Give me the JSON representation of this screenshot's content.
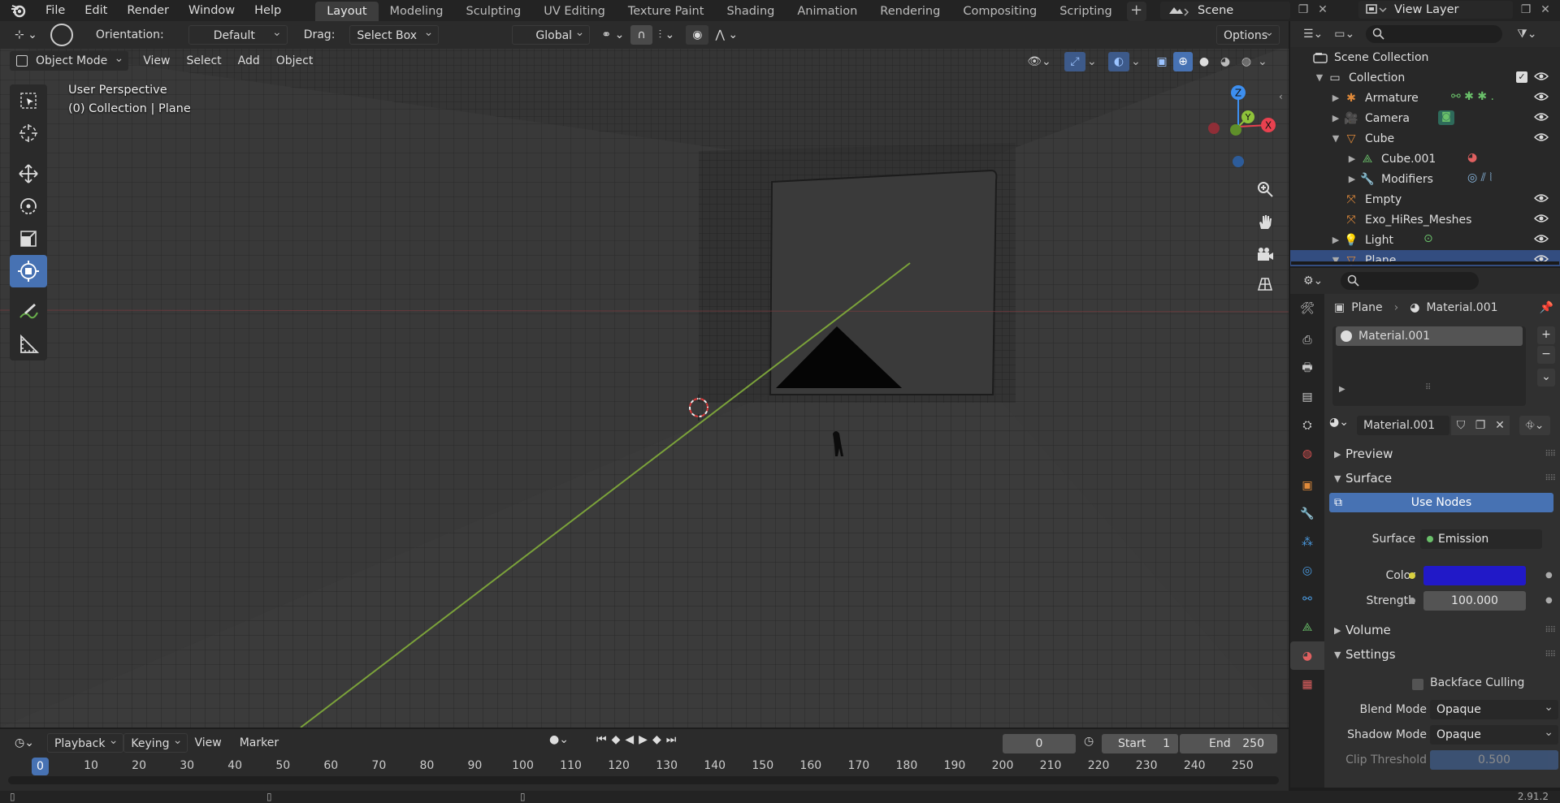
{
  "menubar": {
    "items": [
      "File",
      "Edit",
      "Render",
      "Window",
      "Help"
    ],
    "workspaces": [
      "Layout",
      "Modeling",
      "Sculpting",
      "UV Editing",
      "Texture Paint",
      "Shading",
      "Animation",
      "Rendering",
      "Compositing",
      "Scripting"
    ],
    "active_workspace": "Layout",
    "add_label": "+",
    "scene_name": "Scene",
    "view_layer": "View Layer"
  },
  "viewport": {
    "header": {
      "orientation_label": "Orientation:",
      "orientation_value": "Default",
      "drag_label": "Drag:",
      "drag_value": "Select Box",
      "transform_space": "Global",
      "options_label": "Options"
    },
    "header2": {
      "mode": "Object Mode",
      "menus": [
        "View",
        "Select",
        "Add",
        "Object"
      ]
    },
    "overlay": {
      "perspective": "User Perspective",
      "collection": "(0) Collection | Plane"
    },
    "gizmo": {
      "z": "Z",
      "y": "Y",
      "x": "X"
    },
    "tools": [
      "select-box",
      "cursor",
      "move",
      "rotate",
      "scale",
      "transform",
      "annotate",
      "measure"
    ],
    "active_tool": "transform"
  },
  "outliner": {
    "scene_collection": "Scene Collection",
    "rows": [
      {
        "label": "Collection",
        "depth": 1,
        "expanded": true,
        "icon": "collection-icon"
      },
      {
        "label": "Armature",
        "depth": 2,
        "expanded": false,
        "icon": "armature-icon"
      },
      {
        "label": "Camera",
        "depth": 2,
        "expanded": false,
        "icon": "camera-icon"
      },
      {
        "label": "Cube",
        "depth": 2,
        "expanded": true,
        "icon": "mesh-icon"
      },
      {
        "label": "Cube.001",
        "depth": 3,
        "expanded": false,
        "icon": "mesh-data-icon"
      },
      {
        "label": "Modifiers",
        "depth": 3,
        "expanded": false,
        "icon": "wrench-icon"
      },
      {
        "label": "Empty",
        "depth": 2,
        "expanded": null,
        "icon": "empty-icon"
      },
      {
        "label": "Exo_HiRes_Meshes",
        "depth": 2,
        "expanded": null,
        "icon": "empty-icon"
      },
      {
        "label": "Light",
        "depth": 2,
        "expanded": false,
        "icon": "light-icon"
      },
      {
        "label": "Plane",
        "depth": 2,
        "expanded": true,
        "icon": "mesh-icon",
        "selected": true
      }
    ]
  },
  "properties": {
    "breadcrumb_object": "Plane",
    "breadcrumb_material": "Material.001",
    "slot_name": "Material.001",
    "material_name": "Material.001",
    "panels": {
      "preview": "Preview",
      "surface": "Surface",
      "use_nodes": "Use Nodes",
      "surface_label": "Surface",
      "surface_value": "Emission",
      "color_label": "Color",
      "color_value": "#2119c8",
      "strength_label": "Strength",
      "strength_value": "100.000",
      "volume": "Volume",
      "settings": "Settings",
      "backface_culling": "Backface Culling",
      "blend_mode_label": "Blend Mode",
      "blend_mode_value": "Opaque",
      "shadow_mode_label": "Shadow Mode",
      "shadow_mode_value": "Opaque",
      "clip_threshold_label": "Clip Threshold",
      "clip_threshold_value": "0.500"
    }
  },
  "timeline": {
    "menus": [
      "Playback",
      "Keying",
      "View",
      "Marker"
    ],
    "current_frame": "0",
    "start_label": "Start",
    "start_value": "1",
    "end_label": "End",
    "end_value": "250",
    "ticks": [
      "0",
      "10",
      "20",
      "30",
      "40",
      "50",
      "60",
      "70",
      "80",
      "90",
      "100",
      "110",
      "120",
      "130",
      "140",
      "150",
      "160",
      "170",
      "180",
      "190",
      "200",
      "210",
      "220",
      "230",
      "240",
      "250"
    ]
  },
  "statusbar": {
    "version": "2.91.2"
  },
  "colors": {
    "accent": "#4772b3",
    "selected_row": "#334d80",
    "x_axis": "#e8414f",
    "y_axis": "#8fc33a",
    "z_axis": "#3d8ff0",
    "emission_color": "#2119c8"
  }
}
